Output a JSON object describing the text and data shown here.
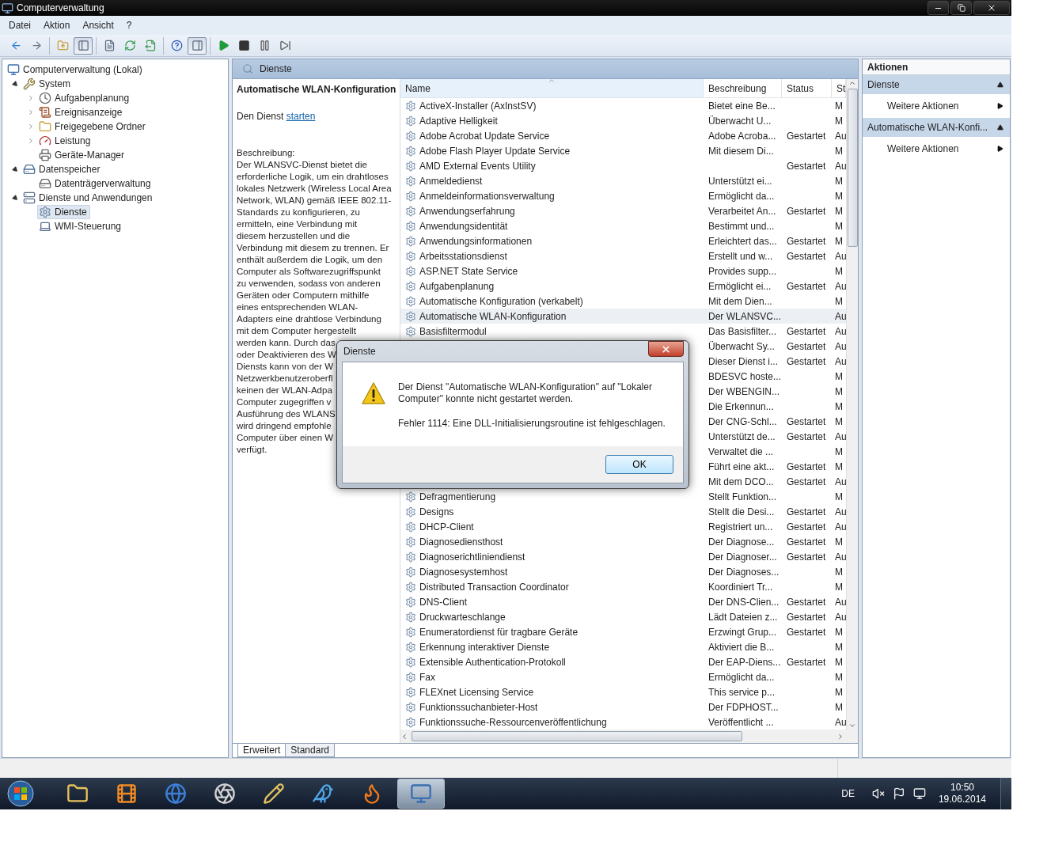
{
  "window": {
    "title": "Computerverwaltung"
  },
  "menu": [
    "Datei",
    "Aktion",
    "Ansicht",
    "?"
  ],
  "toolbar_groups": [
    {
      "buttons": [
        {
          "pressed": false
        },
        {
          "pressed": false
        }
      ]
    },
    {
      "buttons": [
        {
          "pressed": false
        },
        {
          "pressed": true
        }
      ]
    },
    {
      "buttons": [
        {
          "pressed": false
        },
        {
          "pressed": false
        },
        {
          "pressed": false
        }
      ]
    },
    {
      "buttons": [
        {
          "pressed": false
        },
        {
          "pressed": true
        }
      ]
    },
    {
      "buttons": [
        {
          "pressed": false
        },
        {
          "pressed": false
        },
        {
          "pressed": false
        },
        {
          "pressed": false
        }
      ]
    }
  ],
  "tree": [
    {
      "label": "Computerverwaltung (Lokal)",
      "selected": false,
      "children": [
        {
          "label": "System",
          "expanded": true,
          "selected": false,
          "children": [
            {
              "label": "Aufgabenplanung",
              "expanded": false,
              "selected": false
            },
            {
              "label": "Ereignisanzeige",
              "expanded": false,
              "selected": false
            },
            {
              "label": "Freigegebene Ordner",
              "expanded": false,
              "selected": false
            },
            {
              "label": "Leistung",
              "expanded": false,
              "selected": false
            },
            {
              "label": "Geräte-Manager",
              "selected": false
            }
          ]
        },
        {
          "label": "Datenspeicher",
          "expanded": true,
          "selected": false,
          "children": [
            {
              "label": "Datenträgerverwaltung",
              "selected": false
            }
          ]
        },
        {
          "label": "Dienste und Anwendungen",
          "expanded": true,
          "selected": false,
          "children": [
            {
              "label": "Dienste",
              "selected": true
            },
            {
              "label": "WMI-Steuerung",
              "selected": false
            }
          ]
        }
      ]
    }
  ],
  "center": {
    "header": "Dienste",
    "details": {
      "title": "Automatische WLAN-Konfiguration",
      "action_prefix": "Den Dienst",
      "action_link": "starten",
      "description_label": "Beschreibung:",
      "description_lines": [
        "Der WLANSVC-Dienst bietet die",
        "erforderliche Logik, um ein drahtloses",
        "lokales Netzwerk (Wireless Local Area",
        "Network, WLAN) gemäß IEEE 802.11-",
        "Standards zu konfigurieren, zu",
        "ermitteln, eine Verbindung mit",
        "diesem herzustellen und die",
        "Verbindung mit diesem zu trennen. Er",
        "enthält außerdem die Logik, um den",
        "Computer als Softwarezugriffspunkt",
        "zu verwenden, sodass von anderen",
        "Geräten oder Computern mithilfe",
        "eines entsprechenden WLAN-",
        "Adapters eine drahtlose Verbindung",
        "mit dem Computer hergestellt",
        "werden kann. Durch das",
        "oder Deaktivieren des W",
        "Diensts kann von der W",
        "Netzwerkbenutzeroberfl",
        "keinen der WLAN-Adpa",
        "Computer zugegriffen v",
        "Ausführung des WLANS",
        "wird dringend empfohle",
        "Computer über einen W",
        "verfügt."
      ]
    },
    "table": {
      "columns": [
        "Name",
        "Beschreibung",
        "Status",
        "St"
      ],
      "rows": [
        {
          "name": "ActiveX-Installer (AxInstSV)",
          "description": "Bietet eine Be...",
          "start": "M",
          "selected": false
        },
        {
          "name": "Adaptive Helligkeit",
          "description": "Überwacht U...",
          "start": "M",
          "selected": false
        },
        {
          "name": "Adobe Acrobat Update Service",
          "description": "Adobe Acroba...",
          "status": "Gestartet",
          "start": "Au",
          "selected": false
        },
        {
          "name": "Adobe Flash Player Update Service",
          "description": "Mit diesem Di...",
          "start": "M",
          "selected": false
        },
        {
          "name": "AMD External Events Utility",
          "status": "Gestartet",
          "start": "Au",
          "selected": false
        },
        {
          "name": "Anmeldedienst",
          "description": "Unterstützt ei...",
          "start": "M",
          "selected": false
        },
        {
          "name": "Anmeldeinformationsverwaltung",
          "description": "Ermöglicht da...",
          "start": "M",
          "selected": false
        },
        {
          "name": "Anwendungserfahrung",
          "description": "Verarbeitet An...",
          "status": "Gestartet",
          "start": "M",
          "selected": false
        },
        {
          "name": "Anwendungsidentität",
          "description": "Bestimmt und...",
          "start": "M",
          "selected": false
        },
        {
          "name": "Anwendungsinformationen",
          "description": "Erleichtert das...",
          "status": "Gestartet",
          "start": "M",
          "selected": false
        },
        {
          "name": "Arbeitsstationsdienst",
          "description": "Erstellt und w...",
          "status": "Gestartet",
          "start": "Au",
          "selected": false
        },
        {
          "name": "ASP.NET State Service",
          "description": "Provides supp...",
          "start": "M",
          "selected": false
        },
        {
          "name": "Aufgabenplanung",
          "description": "Ermöglicht ei...",
          "status": "Gestartet",
          "start": "Au",
          "selected": false
        },
        {
          "name": "Automatische Konfiguration (verkabelt)",
          "description": "Mit dem Dien...",
          "start": "M",
          "selected": false
        },
        {
          "name": "Automatische WLAN-Konfiguration",
          "description": "Der WLANSVC...",
          "start": "Au",
          "selected": true
        },
        {
          "name": "Basisfiltermodul",
          "description": "Das Basisfilter...",
          "status": "Gestartet",
          "start": "Au",
          "selected": false
        },
        {
          "description": "Überwacht Sy...",
          "status": "Gestartet",
          "start": "Au",
          "selected": false
        },
        {
          "description": "Dieser Dienst i...",
          "status": "Gestartet",
          "start": "Au",
          "selected": false
        },
        {
          "description": "BDESVC hoste...",
          "start": "M",
          "selected": false
        },
        {
          "description": "Der WBENGIN...",
          "start": "M",
          "selected": false
        },
        {
          "description": "Die Erkennun...",
          "start": "M",
          "selected": false
        },
        {
          "description": "Der CNG-Schl...",
          "status": "Gestartet",
          "start": "M",
          "selected": false
        },
        {
          "description": "Unterstützt de...",
          "status": "Gestartet",
          "start": "Au",
          "selected": false
        },
        {
          "description": "Verwaltet die ...",
          "start": "M",
          "selected": false
        },
        {
          "description": "Führt eine akt...",
          "status": "Gestartet",
          "start": "M",
          "selected": false
        },
        {
          "description": "Mit dem DCO...",
          "status": "Gestartet",
          "start": "Au",
          "selected": false
        },
        {
          "name": "Defragmentierung",
          "description": "Stellt Funktion...",
          "start": "M",
          "selected": false
        },
        {
          "name": "Designs",
          "description": "Stellt die Desi...",
          "status": "Gestartet",
          "start": "Au",
          "selected": false
        },
        {
          "name": "DHCP-Client",
          "description": "Registriert un...",
          "status": "Gestartet",
          "start": "Au",
          "selected": false
        },
        {
          "name": "Diagnosediensthost",
          "description": "Der Diagnose...",
          "status": "Gestartet",
          "start": "M",
          "selected": false
        },
        {
          "name": "Diagnoserichtliniendienst",
          "description": "Der Diagnoser...",
          "status": "Gestartet",
          "start": "Au",
          "selected": false
        },
        {
          "name": "Diagnosesystemhost",
          "description": "Der Diagnoses...",
          "start": "M",
          "selected": false
        },
        {
          "name": "Distributed Transaction Coordinator",
          "description": "Koordiniert Tr...",
          "start": "M",
          "selected": false
        },
        {
          "name": "DNS-Client",
          "description": "Der DNS-Clien...",
          "status": "Gestartet",
          "start": "Au",
          "selected": false
        },
        {
          "name": "Druckwarteschlange",
          "description": "Lädt Dateien z...",
          "status": "Gestartet",
          "start": "Au",
          "selected": false
        },
        {
          "name": "Enumeratordienst für tragbare Geräte",
          "description": "Erzwingt Grup...",
          "status": "Gestartet",
          "start": "M",
          "selected": false
        },
        {
          "name": "Erkennung interaktiver Dienste",
          "description": "Aktiviert die B...",
          "start": "M",
          "selected": false
        },
        {
          "name": "Extensible Authentication-Protokoll",
          "description": "Der EAP-Diens...",
          "status": "Gestartet",
          "start": "M",
          "selected": false
        },
        {
          "name": "Fax",
          "description": "Ermöglicht da...",
          "start": "M",
          "selected": false
        },
        {
          "name": "FLEXnet Licensing Service",
          "description": "This service p...",
          "start": "M",
          "selected": false
        },
        {
          "name": "Funktionssuchanbieter-Host",
          "description": "Der FDPHOST...",
          "start": "M",
          "selected": false
        },
        {
          "name": "Funktionssuche-Ressourcenveröffentlichung",
          "description": "Veröffentlicht ...",
          "start": "Au",
          "selected": false
        }
      ]
    },
    "tabs": [
      {
        "label": "Erweitert",
        "selected": true
      },
      {
        "label": "Standard",
        "selected": false
      }
    ]
  },
  "actions": {
    "title": "Aktionen",
    "sections": [
      {
        "title": "Dienste",
        "expanded": true,
        "items": [
          "Weitere Aktionen"
        ]
      },
      {
        "title": "Automatische WLAN-Konfi...",
        "expanded": true,
        "items": [
          "Weitere Aktionen"
        ]
      }
    ]
  },
  "dialog": {
    "title": "Dienste",
    "message": "Der Dienst \"Automatische WLAN-Konfiguration\" auf \"Lokaler Computer\" konnte nicht gestartet werden.",
    "error": "Fehler 1114: Eine DLL-Initialisierungsroutine ist fehlgeschlagen.",
    "button": "OK"
  },
  "taskbar": {
    "apps": [
      {
        "selected": false
      },
      {
        "selected": false
      },
      {
        "selected": false
      },
      {
        "selected": false
      },
      {
        "selected": false
      },
      {
        "selected": false
      },
      {
        "selected": false
      },
      {
        "selected": true
      }
    ],
    "language": "DE",
    "time": "10:50",
    "date": "19.06.2014"
  }
}
